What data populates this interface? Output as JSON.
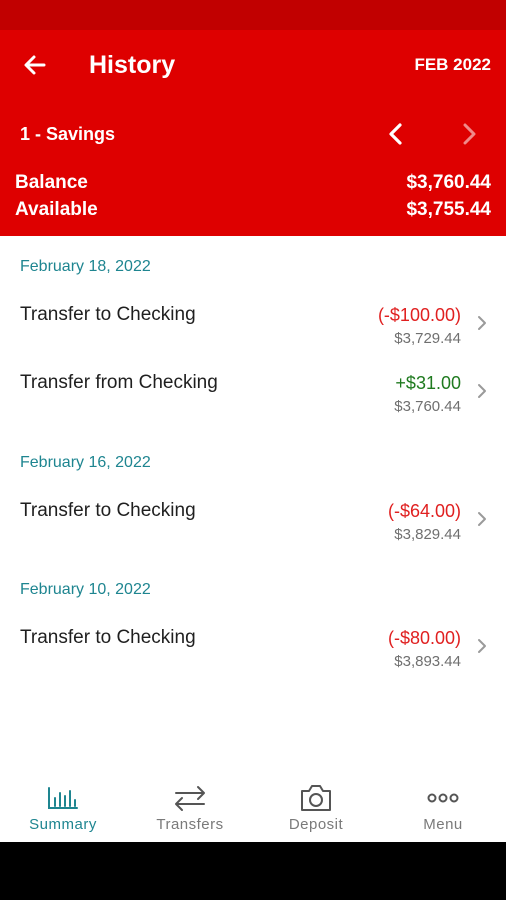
{
  "header": {
    "title": "History",
    "month": "FEB 2022",
    "account": "1 - Savings",
    "balance_label": "Balance",
    "balance_value": "$3,760.44",
    "available_label": "Available",
    "available_value": "$3,755.44"
  },
  "groups": [
    {
      "date": "February 18, 2022",
      "transactions": [
        {
          "description": "Transfer to Checking",
          "amount": "(-$100.00)",
          "balance": "$3,729.44"
        },
        {
          "description": "Transfer from Checking",
          "amount": "+$31.00",
          "balance": "$3,760.44"
        }
      ]
    },
    {
      "date": "February 16, 2022",
      "transactions": [
        {
          "description": "Transfer to Checking",
          "amount": "(-$64.00)",
          "balance": "$3,829.44"
        }
      ]
    },
    {
      "date": "February 10, 2022",
      "transactions": [
        {
          "description": "Transfer to Checking",
          "amount": "(-$80.00)",
          "balance": "$3,893.44"
        }
      ]
    }
  ],
  "tabs": [
    {
      "label": "Summary",
      "icon": "bar-chart-icon",
      "active": true
    },
    {
      "label": "Transfers",
      "icon": "swap-arrows-icon",
      "active": false
    },
    {
      "label": "Deposit",
      "icon": "camera-icon",
      "active": false
    },
    {
      "label": "Menu",
      "icon": "more-dots-icon",
      "active": false
    }
  ],
  "colors": {
    "header_bg": "#de0000",
    "status_bar": "#c10000",
    "accent_teal": "#1e8590",
    "negative": "#e02020",
    "positive": "#1f7a1f"
  }
}
